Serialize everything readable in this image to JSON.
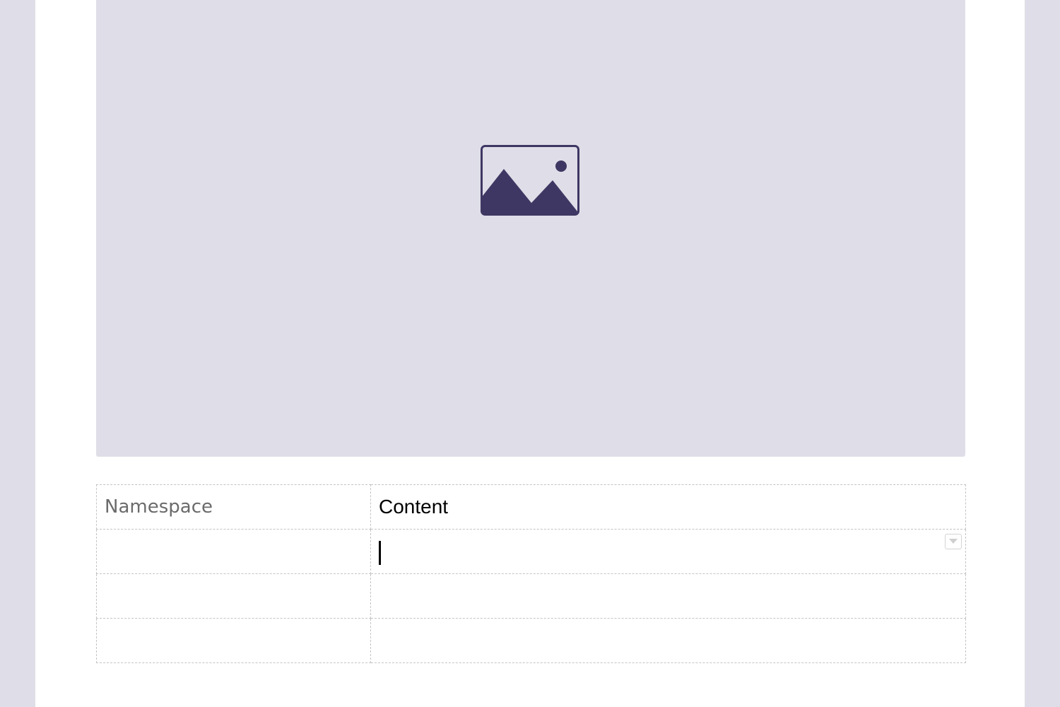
{
  "image_block": {
    "icon": "image-placeholder-icon",
    "background_color": "#dfdee8",
    "icon_color": "#3f3763"
  },
  "table": {
    "columns": [
      "Namespace",
      "Content"
    ],
    "rows": [
      {
        "namespace": "",
        "content": ""
      },
      {
        "namespace": "",
        "content": ""
      },
      {
        "namespace": "",
        "content": ""
      }
    ],
    "active_cell_icon": "chevron-down-icon"
  }
}
